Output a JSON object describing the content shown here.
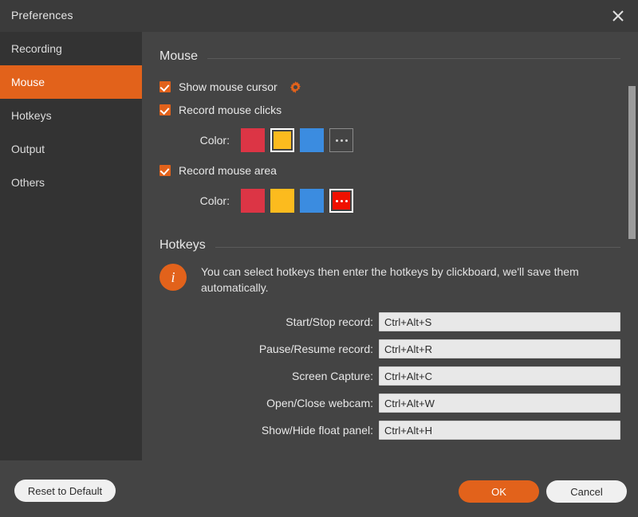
{
  "window": {
    "title": "Preferences",
    "close_icon": "close-icon"
  },
  "theme": {
    "accent": "#e2621b",
    "sidebar_bg": "#333333",
    "content_bg": "#444444",
    "titlebar_bg": "#3b3b3b",
    "input_bg": "#e8e8e8",
    "text": "#e8e8e8"
  },
  "sidebar": {
    "items": [
      {
        "label": "Recording",
        "active": false
      },
      {
        "label": "Mouse",
        "active": true
      },
      {
        "label": "Hotkeys",
        "active": false
      },
      {
        "label": "Output",
        "active": false
      },
      {
        "label": "Others",
        "active": false
      }
    ]
  },
  "mouse_section": {
    "title": "Mouse",
    "show_cursor": {
      "label": "Show mouse cursor",
      "checked": true,
      "settings_icon": "gear-icon"
    },
    "record_clicks": {
      "label": "Record mouse clicks",
      "checked": true,
      "color_label": "Color:",
      "swatches": [
        {
          "name": "red",
          "hex": "#dc3545",
          "selected": false,
          "more": false
        },
        {
          "name": "yellow",
          "hex": "#fcbb1e",
          "selected": true,
          "more": false
        },
        {
          "name": "blue",
          "hex": "#3b8ce0",
          "selected": false,
          "more": false
        },
        {
          "name": "more",
          "hex": "#444444",
          "selected": false,
          "more": true
        }
      ]
    },
    "record_area": {
      "label": "Record mouse area",
      "checked": true,
      "color_label": "Color:",
      "swatches": [
        {
          "name": "red",
          "hex": "#dc3545",
          "selected": false,
          "more": false
        },
        {
          "name": "yellow",
          "hex": "#fcbb1e",
          "selected": false,
          "more": false
        },
        {
          "name": "blue",
          "hex": "#3b8ce0",
          "selected": false,
          "more": false
        },
        {
          "name": "more",
          "hex": "#f01000",
          "selected": true,
          "more": true
        }
      ]
    }
  },
  "hotkeys_section": {
    "title": "Hotkeys",
    "info_icon": "info-icon",
    "info_text": "You can select hotkeys then enter the hotkeys by clickboard, we'll save them automatically.",
    "rows": [
      {
        "label": "Start/Stop record:",
        "value": "Ctrl+Alt+S"
      },
      {
        "label": "Pause/Resume record:",
        "value": "Ctrl+Alt+R"
      },
      {
        "label": "Screen Capture:",
        "value": "Ctrl+Alt+C"
      },
      {
        "label": "Open/Close webcam:",
        "value": "Ctrl+Alt+W"
      },
      {
        "label": "Show/Hide float panel:",
        "value": "Ctrl+Alt+H"
      }
    ]
  },
  "footer": {
    "reset_label": "Reset to Default",
    "ok_label": "OK",
    "cancel_label": "Cancel"
  }
}
